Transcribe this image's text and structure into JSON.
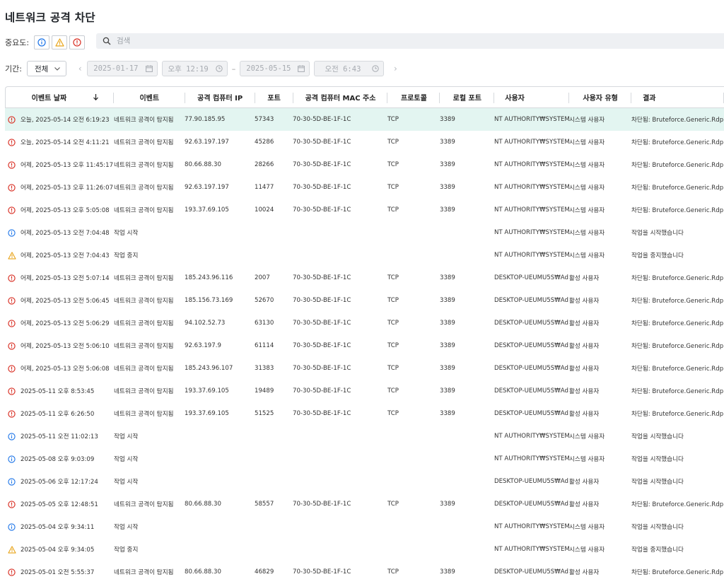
{
  "page": {
    "title": "네트워크 공격 차단"
  },
  "filters": {
    "severity_label": "중요도:",
    "search_placeholder": "검색",
    "period_label": "기간:",
    "period_value": "전체",
    "start_date": "2025-01-17",
    "start_time": "오후 12:19",
    "range_sep": "–",
    "end_date": "2025-05-15",
    "end_time": "오전 6:43"
  },
  "columns": [
    "이벤트 날짜",
    "이벤트",
    "공격 컴퓨터 IP",
    "포트",
    "공격 컴퓨터 MAC 주소",
    "프로토콜",
    "로컬 포트",
    "사용자",
    "사용자 유형",
    "결과"
  ],
  "rows": [
    {
      "sev": "error",
      "date": "오늘, 2025-05-14 오전 6:19:23",
      "event": "네트워크 공격이 탐지됨",
      "ip": "77.90.185.95",
      "port": "57343",
      "mac": "70-30-5D-BE-1F-1C",
      "proto": "TCP",
      "lport": "3389",
      "user": "NT AUTHORITY₩SYSTEM",
      "utype": "시스템 사용자",
      "result": "차단됨: Bruteforce.Generic.Rdp.a"
    },
    {
      "sev": "error",
      "date": "오늘, 2025-05-14 오전 4:11:21",
      "event": "네트워크 공격이 탐지됨",
      "ip": "92.63.197.197",
      "port": "45286",
      "mac": "70-30-5D-BE-1F-1C",
      "proto": "TCP",
      "lport": "3389",
      "user": "NT AUTHORITY₩SYSTEM",
      "utype": "시스템 사용자",
      "result": "차단됨: Bruteforce.Generic.Rdp.a"
    },
    {
      "sev": "error",
      "date": "어제, 2025-05-13 오후 11:45:17",
      "event": "네트워크 공격이 탐지됨",
      "ip": "80.66.88.30",
      "port": "28266",
      "mac": "70-30-5D-BE-1F-1C",
      "proto": "TCP",
      "lport": "3389",
      "user": "NT AUTHORITY₩SYSTEM",
      "utype": "시스템 사용자",
      "result": "차단됨: Bruteforce.Generic.Rdp.d"
    },
    {
      "sev": "error",
      "date": "어제, 2025-05-13 오후 11:26:07",
      "event": "네트워크 공격이 탐지됨",
      "ip": "92.63.197.197",
      "port": "11477",
      "mac": "70-30-5D-BE-1F-1C",
      "proto": "TCP",
      "lport": "3389",
      "user": "NT AUTHORITY₩SYSTEM",
      "utype": "시스템 사용자",
      "result": "차단됨: Bruteforce.Generic.Rdp.d"
    },
    {
      "sev": "error",
      "date": "어제, 2025-05-13 오후 5:05:08",
      "event": "네트워크 공격이 탐지됨",
      "ip": "193.37.69.105",
      "port": "10024",
      "mac": "70-30-5D-BE-1F-1C",
      "proto": "TCP",
      "lport": "3389",
      "user": "NT AUTHORITY₩SYSTEM",
      "utype": "시스템 사용자",
      "result": "차단됨: Bruteforce.Generic.Rdp.d"
    },
    {
      "sev": "info",
      "date": "어제, 2025-05-13 오전 7:04:48",
      "event": "작업 시작",
      "ip": "",
      "port": "",
      "mac": "",
      "proto": "",
      "lport": "",
      "user": "NT AUTHORITY₩SYSTEM",
      "utype": "시스템 사용자",
      "result": "작업을 시작했습니다"
    },
    {
      "sev": "warn",
      "date": "어제, 2025-05-13 오전 7:04:43",
      "event": "작업 중지",
      "ip": "",
      "port": "",
      "mac": "",
      "proto": "",
      "lport": "",
      "user": "NT AUTHORITY₩SYSTEM",
      "utype": "시스템 사용자",
      "result": "작업을 중지했습니다"
    },
    {
      "sev": "error",
      "date": "어제, 2025-05-13 오전 5:07:14",
      "event": "네트워크 공격이 탐지됨",
      "ip": "185.243.96.116",
      "port": "2007",
      "mac": "70-30-5D-BE-1F-1C",
      "proto": "TCP",
      "lport": "3389",
      "user": "DESKTOP-UEUMU5S₩Ad",
      "utype": "활성 사용자",
      "result": "차단됨: Bruteforce.Generic.Rdp.a"
    },
    {
      "sev": "error",
      "date": "어제, 2025-05-13 오전 5:06:45",
      "event": "네트워크 공격이 탐지됨",
      "ip": "185.156.73.169",
      "port": "52670",
      "mac": "70-30-5D-BE-1F-1C",
      "proto": "TCP",
      "lport": "3389",
      "user": "DESKTOP-UEUMU5S₩Ad",
      "utype": "활성 사용자",
      "result": "차단됨: Bruteforce.Generic.Rdp.a"
    },
    {
      "sev": "error",
      "date": "어제, 2025-05-13 오전 5:06:29",
      "event": "네트워크 공격이 탐지됨",
      "ip": "94.102.52.73",
      "port": "63130",
      "mac": "70-30-5D-BE-1F-1C",
      "proto": "TCP",
      "lport": "3389",
      "user": "DESKTOP-UEUMU5S₩Ad",
      "utype": "활성 사용자",
      "result": "차단됨: Bruteforce.Generic.Rdp.a"
    },
    {
      "sev": "error",
      "date": "어제, 2025-05-13 오전 5:06:10",
      "event": "네트워크 공격이 탐지됨",
      "ip": "92.63.197.9",
      "port": "61114",
      "mac": "70-30-5D-BE-1F-1C",
      "proto": "TCP",
      "lport": "3389",
      "user": "DESKTOP-UEUMU5S₩Ad",
      "utype": "활성 사용자",
      "result": "차단됨: Bruteforce.Generic.Rdp.a"
    },
    {
      "sev": "error",
      "date": "어제, 2025-05-13 오전 5:06:08",
      "event": "네트워크 공격이 탐지됨",
      "ip": "185.243.96.107",
      "port": "31383",
      "mac": "70-30-5D-BE-1F-1C",
      "proto": "TCP",
      "lport": "3389",
      "user": "DESKTOP-UEUMU5S₩Ad",
      "utype": "활성 사용자",
      "result": "차단됨: Bruteforce.Generic.Rdp.a"
    },
    {
      "sev": "error",
      "date": "2025-05-11 오후 8:53:45",
      "event": "네트워크 공격이 탐지됨",
      "ip": "193.37.69.105",
      "port": "19489",
      "mac": "70-30-5D-BE-1F-1C",
      "proto": "TCP",
      "lport": "3389",
      "user": "DESKTOP-UEUMU5S₩Ad",
      "utype": "활성 사용자",
      "result": "차단됨: Bruteforce.Generic.Rdp.d"
    },
    {
      "sev": "error",
      "date": "2025-05-11 오후 6:26:50",
      "event": "네트워크 공격이 탐지됨",
      "ip": "193.37.69.105",
      "port": "51525",
      "mac": "70-30-5D-BE-1F-1C",
      "proto": "TCP",
      "lport": "3389",
      "user": "DESKTOP-UEUMU5S₩Ad",
      "utype": "활성 사용자",
      "result": "차단됨: Bruteforce.Generic.Rdp.d"
    },
    {
      "sev": "info",
      "date": "2025-05-11 오전 11:02:13",
      "event": "작업 시작",
      "ip": "",
      "port": "",
      "mac": "",
      "proto": "",
      "lport": "",
      "user": "NT AUTHORITY₩SYSTEM",
      "utype": "시스템 사용자",
      "result": "작업을 시작했습니다"
    },
    {
      "sev": "info",
      "date": "2025-05-08 오후 9:03:09",
      "event": "작업 시작",
      "ip": "",
      "port": "",
      "mac": "",
      "proto": "",
      "lport": "",
      "user": "NT AUTHORITY₩SYSTEM",
      "utype": "시스템 사용자",
      "result": "작업을 시작했습니다"
    },
    {
      "sev": "info",
      "date": "2025-05-06 오후 12:17:24",
      "event": "작업 시작",
      "ip": "",
      "port": "",
      "mac": "",
      "proto": "",
      "lport": "",
      "user": "DESKTOP-UEUMU5S₩Ad",
      "utype": "활성 사용자",
      "result": "작업을 시작했습니다"
    },
    {
      "sev": "error",
      "date": "2025-05-05 오후 12:48:51",
      "event": "네트워크 공격이 탐지됨",
      "ip": "80.66.88.30",
      "port": "58557",
      "mac": "70-30-5D-BE-1F-1C",
      "proto": "TCP",
      "lport": "3389",
      "user": "DESKTOP-UEUMU5S₩Ad",
      "utype": "활성 사용자",
      "result": "차단됨: Bruteforce.Generic.Rdp.a"
    },
    {
      "sev": "info",
      "date": "2025-05-04 오후 9:34:11",
      "event": "작업 시작",
      "ip": "",
      "port": "",
      "mac": "",
      "proto": "",
      "lport": "",
      "user": "NT AUTHORITY₩SYSTEM",
      "utype": "시스템 사용자",
      "result": "작업을 시작했습니다"
    },
    {
      "sev": "warn",
      "date": "2025-05-04 오후 9:34:05",
      "event": "작업 중지",
      "ip": "",
      "port": "",
      "mac": "",
      "proto": "",
      "lport": "",
      "user": "NT AUTHORITY₩SYSTEM",
      "utype": "시스템 사용자",
      "result": "작업을 중지했습니다"
    },
    {
      "sev": "error",
      "date": "2025-05-01 오전 5:55:37",
      "event": "네트워크 공격이 탐지됨",
      "ip": "80.66.88.30",
      "port": "46829",
      "mac": "70-30-5D-BE-1F-1C",
      "proto": "TCP",
      "lport": "3389",
      "user": "DESKTOP-UEUMU5S₩Ad",
      "utype": "활성 사용자",
      "result": "차단됨: Bruteforce.Generic.Rdp.d"
    }
  ],
  "selected_row": 0,
  "colors": {
    "error": "#d93025",
    "warn": "#e8a317",
    "info": "#1a73e8",
    "selected": "#e3f5f1"
  },
  "icons": {
    "error": "error-icon",
    "warn": "warning-icon",
    "info": "info-icon",
    "search": "search-icon",
    "calendar": "calendar-icon",
    "clock": "clock-icon",
    "sort": "arrow-down-icon",
    "chevron": "chevron-down-icon"
  }
}
